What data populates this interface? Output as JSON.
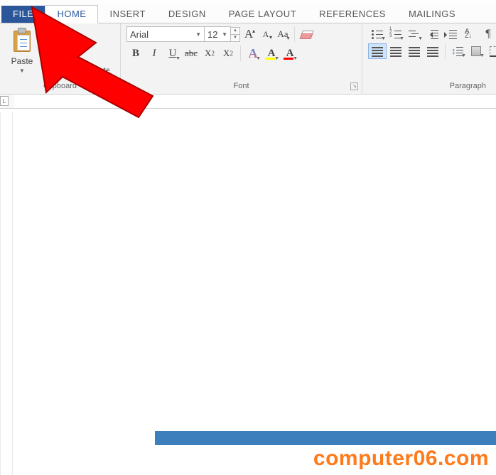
{
  "tabs": {
    "file": "FILE",
    "home": "HOME",
    "insert": "INSERT",
    "design": "DESIGN",
    "page_layout": "PAGE LAYOUT",
    "references": "REFERENCES",
    "mailings": "MAILINGS"
  },
  "clipboard": {
    "paste": "Paste",
    "format_painter": "Format Painter",
    "group_label": "Clipboard"
  },
  "font": {
    "name": "Arial",
    "size": "12",
    "group_label": "Font",
    "bold": "B",
    "italic": "I",
    "underline": "U",
    "strike": "abc",
    "sub_base": "X",
    "sub": "2",
    "sup_base": "X",
    "sup": "2",
    "grow": "A",
    "shrink": "A",
    "case": "Aa",
    "effects": "A",
    "highlight": "A",
    "color": "A"
  },
  "paragraph": {
    "group_label": "Paragraph"
  },
  "ruler": {
    "margin_marker": "L"
  },
  "watermark": "computer06.com"
}
